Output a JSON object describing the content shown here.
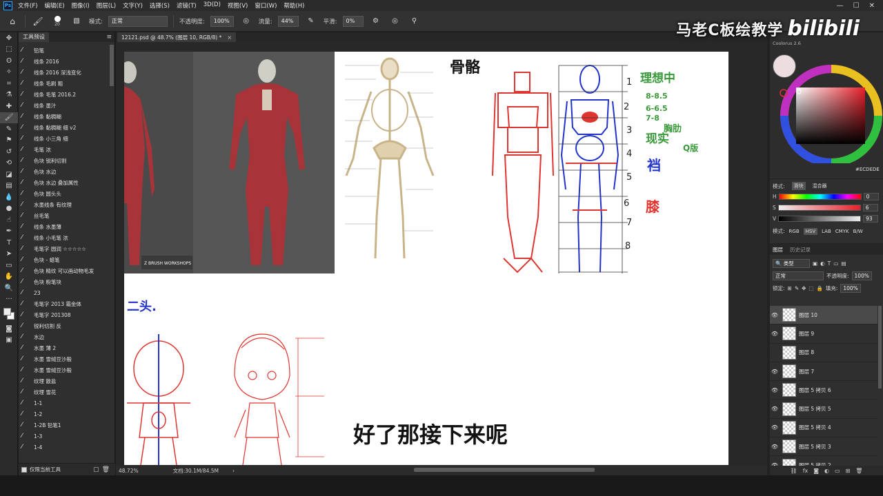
{
  "menubar": {
    "logo": "Ps",
    "items": [
      "文件(F)",
      "编辑(E)",
      "图像(I)",
      "图层(L)",
      "文字(Y)",
      "选择(S)",
      "滤镜(T)",
      "3D(D)",
      "视图(V)",
      "窗口(W)",
      "帮助(H)"
    ],
    "window_controls": [
      "—",
      "☐",
      "✕"
    ]
  },
  "options": {
    "brush_size": "20",
    "mode_label": "模式:",
    "mode_value": "正常",
    "opacity_label": "不透明度:",
    "opacity_value": "100%",
    "flow_label": "流量:",
    "flow_value": "44%",
    "smooth_label": "平滑:",
    "smooth_value": "0%"
  },
  "watermark": {
    "text": "马老C板绘教学",
    "logo": "bilibili"
  },
  "document": {
    "tab_title": "12121.psd @ 48.7% (图层 10, RGB/8) *",
    "close": "×"
  },
  "presets": {
    "tab_label": "工具预设",
    "items": [
      "铅笔",
      "线条 2016",
      "线条 2016 深浅变化",
      "线条 毛刷 粗",
      "线条 毛笔 2016.2",
      "线条 墨汁",
      "线条 黏稠糊",
      "线条 黏稠糊 细 v2",
      "线条 小三角 细",
      "毛笔 浓",
      "色块 锐利切割",
      "色块 水边",
      "色块 水边 叠加属性",
      "色块 圆头头",
      "水墨线条 有纹理",
      "丝毛笔",
      "线条 水墨薄",
      "线条 小毛笔 浓",
      "毛笔字 圆润 ☆☆☆☆☆",
      "色块 - 蜡笔",
      "色块 精纹 可以画动物毛发",
      "色块 粉笔块",
      "23",
      "毛笔字 2013 霜金体",
      "毛笔字 201308",
      "锐利切割 反",
      "水边",
      "水墨 薄 2",
      "水墨 雪绒豆沙般",
      "水墨 雪绒豆沙般",
      "纹理 散盐",
      "纹理 雪花",
      "1-1",
      "1-2",
      "1-2B 铅笔1",
      "1-3",
      "1-4"
    ],
    "footer_label": "仅限当前工具"
  },
  "canvas": {
    "zbrush_label": "Z BRUSH WORKSHOPS",
    "anatomy_title": "骨骼",
    "notes": [
      "理想中",
      "8-8.5",
      "6-6.5",
      "7-8",
      "胸肋",
      "现实",
      "Q版",
      "裆",
      "膝"
    ],
    "ruler_numbers": [
      "1",
      "2",
      "3",
      "4",
      "5",
      "6",
      "7",
      "8"
    ],
    "chibi_label": "二头.",
    "subtitle": "好了那接下来呢"
  },
  "statusbar": {
    "zoom": "48.72%",
    "doc_info": "文档:30.1M/84.5M"
  },
  "color_panel": {
    "title": "Coolorus 2.6",
    "hex": "#ECDEDE",
    "mode_label": "模式:",
    "tabs": [
      "滑块",
      "混合器"
    ],
    "sliders": [
      {
        "label": "H",
        "value": "0"
      },
      {
        "label": "S",
        "value": "6"
      },
      {
        "label": "V",
        "value": "93"
      }
    ],
    "model_label": "模式:",
    "models": [
      "RGB",
      "HSV",
      "LAB",
      "CMYK",
      "B/W"
    ]
  },
  "layers_panel": {
    "tabs": [
      "图层",
      "历史记录"
    ],
    "filter_type": "类型",
    "blend_mode": "正常",
    "opacity_label": "不透明度:",
    "opacity_value": "100%",
    "lock_label": "锁定:",
    "fill_label": "填充:",
    "fill_value": "100%",
    "layers": [
      "图层 10",
      "图层 9",
      "图层 8",
      "图层 7",
      "图层 5 拷贝 6",
      "图层 5 拷贝 5",
      "图层 5 拷贝 4",
      "图层 5 拷贝 3",
      "图层 5 拷贝 2"
    ]
  },
  "colors": {
    "foreground": "#ECDEDE",
    "red_sketch": "#e0342f",
    "blue_sketch": "#2233cc",
    "green_note": "#3a9a3a",
    "muscle": "#a8343a"
  }
}
